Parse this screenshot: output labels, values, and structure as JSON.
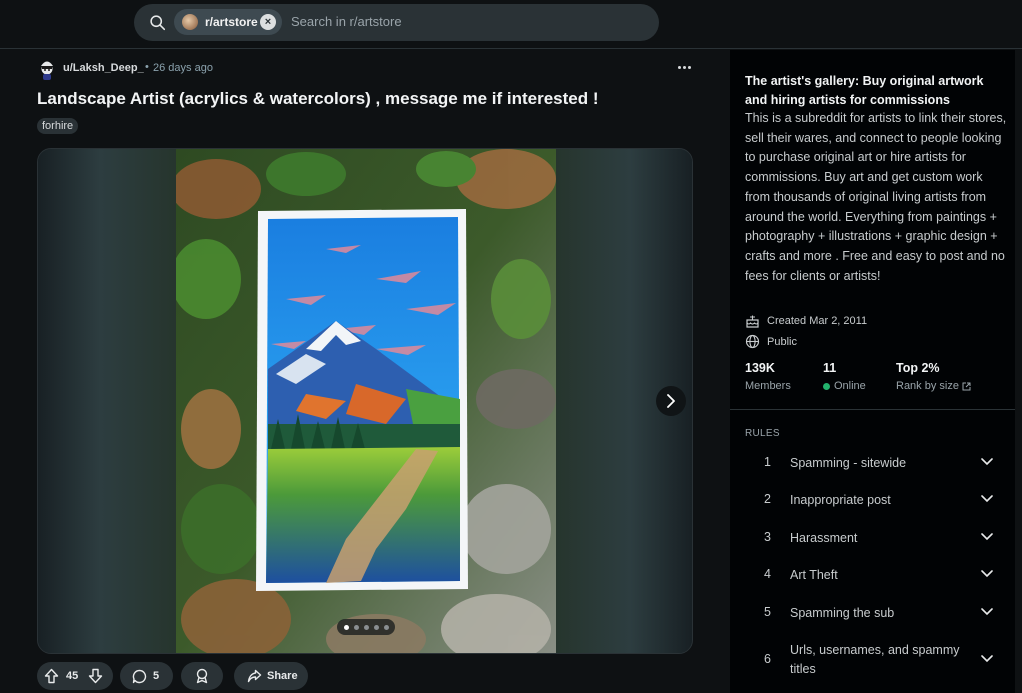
{
  "search": {
    "chip_label": "r/artstore",
    "chip_close": "×",
    "placeholder": "Search in r/artstore"
  },
  "post": {
    "author": "u/Laksh_Deep_",
    "separator": "•",
    "time": "26 days ago",
    "title": "Landscape Artist (acrylics & watercolors) , message me if interested !",
    "flair": "forhire",
    "gallery": {
      "current_index": 1,
      "total_images": 5
    },
    "votes": "45",
    "comments": "5",
    "share_label": "Share"
  },
  "sidebar": {
    "title": "The artist's gallery: Buy original artwork and hiring artists for commissions",
    "description": "This is a subreddit for artists to link their stores, sell their wares, and connect to people looking to purchase original art or hire artists for commissions. Buy art and get custom work from thousands of original living artists from around the world. Everything from paintings + photography + illustrations + graphic design + crafts and more . Free and easy to post and no fees for clients or artists!",
    "created": "Created Mar 2, 2011",
    "visibility": "Public",
    "stats": [
      {
        "value": "139K",
        "label": "Members"
      },
      {
        "value": "11",
        "label": "Online"
      },
      {
        "value": "Top 2%",
        "label": "Rank by size"
      }
    ],
    "rules_heading": "RULES",
    "rules": [
      {
        "num": "1",
        "text": "Spamming - sitewide"
      },
      {
        "num": "2",
        "text": "Inappropriate post"
      },
      {
        "num": "3",
        "text": "Harassment"
      },
      {
        "num": "4",
        "text": "Art Theft"
      },
      {
        "num": "5",
        "text": "Spamming the sub"
      },
      {
        "num": "6",
        "text": "Urls, usernames, and spammy titles"
      }
    ]
  },
  "colors": {
    "background": "#0e1113",
    "sidebar_bg": "#010305",
    "button_bg": "#2a3236",
    "online_green": "#23b26d"
  }
}
